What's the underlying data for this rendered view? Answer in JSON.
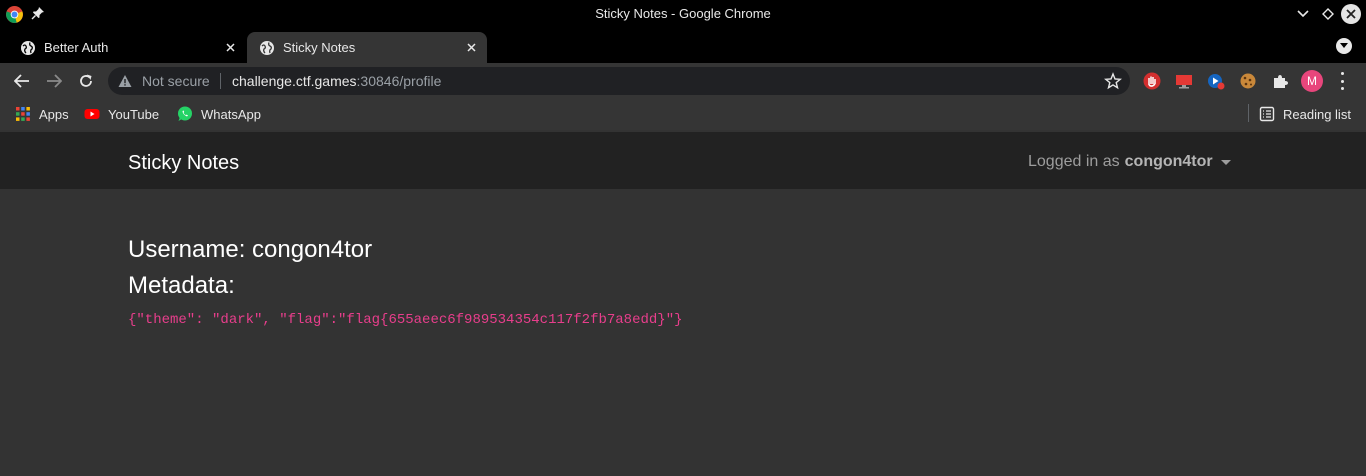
{
  "window": {
    "title": "Sticky Notes - Google Chrome"
  },
  "tabs": [
    {
      "label": "Better Auth",
      "active": false
    },
    {
      "label": "Sticky Notes",
      "active": true
    }
  ],
  "omnibox": {
    "security_label": "Not secure",
    "url_host": "challenge.ctf.games",
    "url_rest": ":30846/profile"
  },
  "profile_avatar": {
    "initial": "M",
    "color": "#e8467c"
  },
  "bookmarks": {
    "items": [
      {
        "label": "Apps",
        "icon": "apps-grid-icon"
      },
      {
        "label": "YouTube",
        "icon": "youtube-icon"
      },
      {
        "label": "WhatsApp",
        "icon": "whatsapp-icon"
      }
    ],
    "reading_list": "Reading list"
  },
  "site": {
    "brand": "Sticky Notes",
    "user_menu": {
      "prefix": "Logged in as",
      "username": "congon4tor"
    }
  },
  "profile": {
    "username_line": "Username: congon4tor",
    "metadata_heading": "Metadata:",
    "metadata_value": "{\"theme\": \"dark\", \"flag\":\"flag{655aeec6f989534354c117f2fb7a8edd}\"}"
  },
  "colors": {
    "page_bg": "#333333",
    "navbar_bg": "#222222",
    "code_pink": "#e83e8c"
  }
}
